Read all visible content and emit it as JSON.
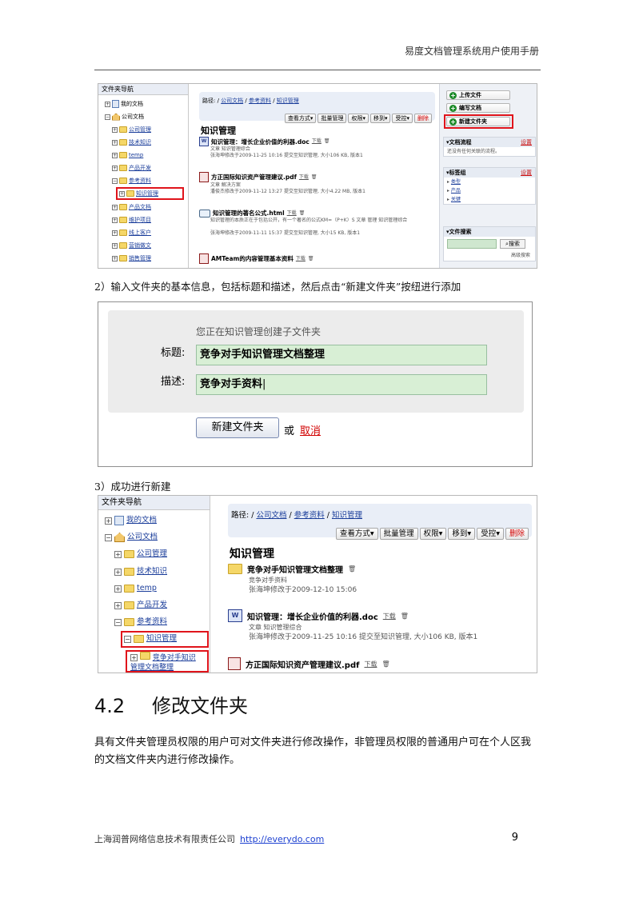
{
  "header": {
    "title": "易度文档管理系统用户使用手册"
  },
  "shot1": {
    "nav_title": "文件夹导航",
    "tree": [
      "我的文档",
      "公司文档",
      "公司管理",
      "技术知识",
      "temp",
      "产品开发",
      "参考资料",
      "知识管理",
      "产品文档",
      "维护项目",
      "线上客户",
      "营销做文",
      "销售管理"
    ],
    "path_label": "路径:",
    "path": [
      "公司文档",
      "参考资料",
      "知识管理"
    ],
    "toolbar": [
      "查看方式▾",
      "批量管理",
      "权限▾",
      "移到▾",
      "受控▾",
      "删除"
    ],
    "title": "知识管理",
    "items": [
      {
        "name": "知识管理：增长企业价值的利器.doc",
        "dl": "下载",
        "tags": "文章  知识管理综合",
        "meta": "张海坤修改于2009-11-25 10:16 提交至知识管理, 大小106 KB, 版本1"
      },
      {
        "name": "方正国际知识资产管理建议.pdf",
        "dl": "下载",
        "tags": "文章  解决方案",
        "meta": "潘俊杰修改于2009-11-12 13:27 提交至知识管理, 大小4.22 MB, 版本1"
      },
      {
        "name": "知识管理的著名公式.html",
        "dl": "下载",
        "tags": "知识管理的本质正在于包括公开，有一个著名的公式KM=（P+K）S  文章  管理  知识管理综合",
        "meta": "张海坤修改于2009-11-11 15:37 提交至知识管理, 大小15 KB, 版本1"
      },
      {
        "name": "AMTeam的内容管理基本资料",
        "dl": "下载"
      }
    ],
    "side_buttons": [
      "上传文件",
      "编写文档",
      "新建文件夹"
    ],
    "panels": [
      {
        "title": "▾文档流程",
        "set": "设置",
        "body": "还没有任何关联的流程。"
      },
      {
        "title": "▾标签组",
        "set": "设置",
        "rows": [
          "类型",
          "产品",
          "关键"
        ]
      },
      {
        "title": "▾文件搜索",
        "search_btn": "搜索",
        "adv": "高级搜索"
      }
    ]
  },
  "caption2": "2）输入文件夹的基本信息，包括标题和描述，然后点击“新建文件夹”按纽进行添加",
  "form": {
    "hint": "您正在知识管理创建子文件夹",
    "title_label": "标题:",
    "title_value": "竞争对手知识管理文档整理",
    "desc_label": "描述:",
    "desc_value": "竞争对手资料",
    "submit": "新建文件夹",
    "or": "或",
    "cancel": "取消"
  },
  "caption3": "3）成功进行新建",
  "shot3": {
    "nav_title": "文件夹导航",
    "tree": [
      "我的文档",
      "公司文档",
      "公司管理",
      "技术知识",
      "temp",
      "产品开发",
      "参考资料",
      "知识管理",
      "竞争对手知识管理文档整理"
    ],
    "path_label": "路径:",
    "path": [
      "公司文档",
      "参考资料",
      "知识管理"
    ],
    "toolbar": [
      "查看方式▾",
      "批量管理",
      "权限▾",
      "移到▾",
      "受控▾",
      "删除"
    ],
    "title": "知识管理",
    "items": [
      {
        "name": "竞争对手知识管理文档整理",
        "desc": "竞争对手资料",
        "meta": "张海坤修改于2009-12-10 15:06"
      },
      {
        "name": "知识管理：增长企业价值的利器.doc",
        "dl": "下载",
        "tags": "文章  知识管理综合",
        "meta": "张海坤修改于2009-11-25 10:16 提交至知识管理, 大小106 KB, 版本1"
      },
      {
        "name": "方正国际知识资产管理建议.pdf",
        "dl": "下载"
      }
    ]
  },
  "section": {
    "num": "4.2",
    "title": "修改文件夹"
  },
  "paragraph": "具有文件夹管理员权限的用户可对文件夹进行修改操作，非管理员权限的普通用户可在个人区我的文档文件夹内进行修改操作。",
  "footer": {
    "company": "上海润普网络信息技术有限责任公司",
    "url": "http://everydo.com",
    "page": "9"
  }
}
